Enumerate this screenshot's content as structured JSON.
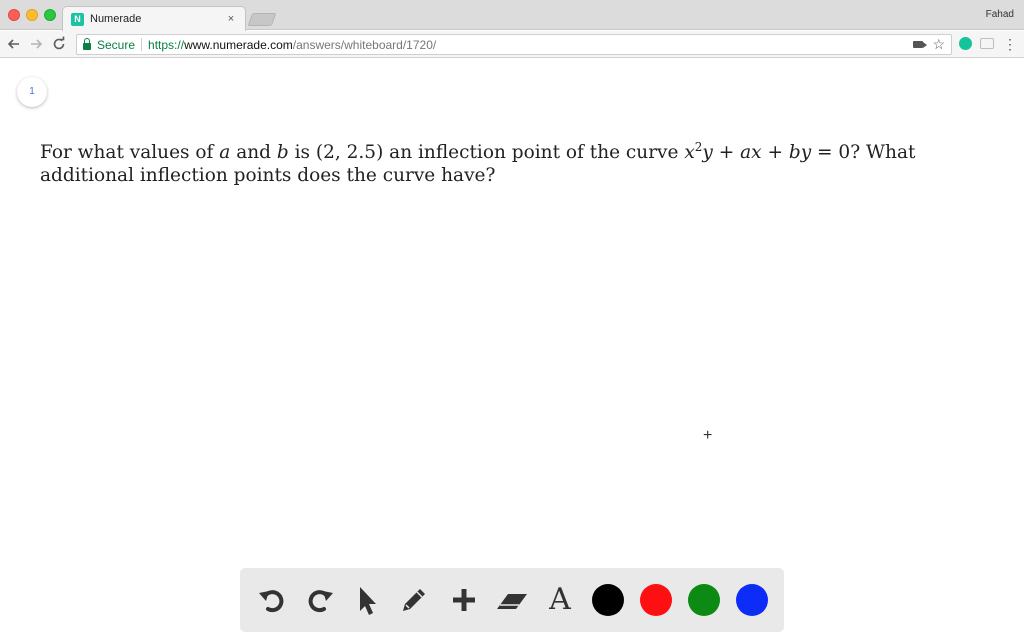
{
  "browser": {
    "tab": {
      "favicon": "N",
      "title": "Numerade",
      "close": "×"
    },
    "profile": "Fahad",
    "nav": {
      "back_icon": "arrow-left-icon",
      "forward_icon": "arrow-right-icon",
      "reload_icon": "reload-icon"
    },
    "omnibox": {
      "secure_label": "Secure",
      "url_scheme": "https://",
      "url_host": "www.numerade.com",
      "url_path": "/answers/whiteboard/1720/"
    }
  },
  "whiteboard": {
    "page_number": "1",
    "question": {
      "p1": "For what values of ",
      "var_a": "a",
      "p2": " and ",
      "var_b": "b",
      "p3": " is (2, 2.5) an inflection point of the curve ",
      "eq_x": "x",
      "eq_exp": "2",
      "eq_y": "y",
      "eq_plus1": " + ",
      "eq_ax": "ax",
      "eq_plus2": " + ",
      "eq_by": "by",
      "eq_end": " = 0",
      "p4": "? What additional inflection points does the curve have?"
    }
  },
  "toolbar": {
    "tools": [
      "undo-icon",
      "redo-icon",
      "pointer-icon",
      "pencil-icon",
      "plus-icon",
      "eraser-icon",
      "text-icon"
    ],
    "text_tool_label": "A",
    "colors": [
      "#000000",
      "#fe0f12",
      "#0c8a14",
      "#0d2cf7"
    ]
  }
}
